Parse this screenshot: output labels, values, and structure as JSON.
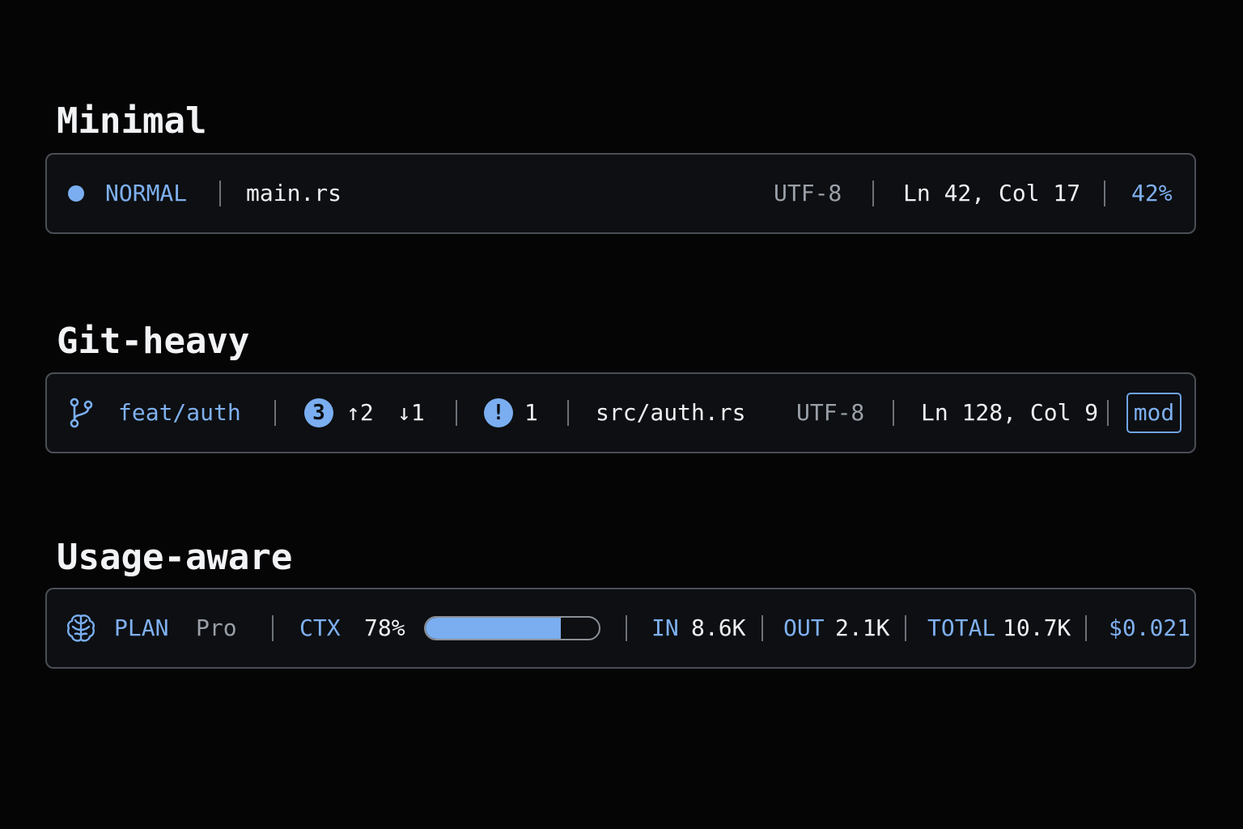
{
  "sections": {
    "minimal": {
      "title": "Minimal",
      "mode": "NORMAL",
      "file": "main.rs",
      "encoding": "UTF-8",
      "position": "Ln 42, Col 17",
      "percent": "42%"
    },
    "git_heavy": {
      "title": "Git-heavy",
      "branch": "feat/auth",
      "changes_count": "3",
      "ahead": "↑2",
      "behind": "↓1",
      "problems_icon": "!",
      "problems_count": "1",
      "file": "src/auth.rs",
      "encoding": "UTF-8",
      "position": "Ln 128, Col 9",
      "status_badge": "mod"
    },
    "usage_aware": {
      "title": "Usage-aware",
      "plan_label": "PLAN",
      "plan_value": "Pro",
      "ctx_label": "CTX",
      "ctx_value": "78%",
      "ctx_fraction": 0.78,
      "in_label": "IN",
      "in_value": "8.6K",
      "out_label": "OUT",
      "out_value": "2.1K",
      "total_label": "TOTAL",
      "total_value": "10.7K",
      "cost": "$0.021"
    }
  },
  "icons": {
    "mode_indicator": "dot-icon",
    "branch": "git-branch-icon",
    "plan": "brain-icon"
  },
  "colors": {
    "accent": "#7aaef0",
    "background": "#050506",
    "bar_background": "#0d0f12",
    "border": "#4a4e55",
    "muted": "#9aa0a8"
  }
}
